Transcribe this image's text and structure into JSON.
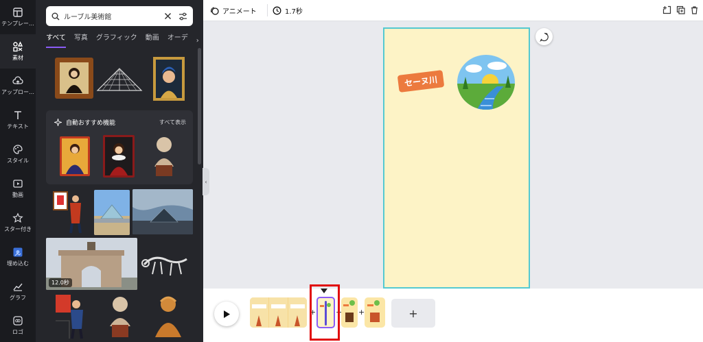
{
  "rail": {
    "items": [
      {
        "label": "テンプレー…",
        "icon": "template-icon"
      },
      {
        "label": "素材",
        "icon": "elements-icon"
      },
      {
        "label": "アップロー…",
        "icon": "upload-icon"
      },
      {
        "label": "テキスト",
        "icon": "text-icon"
      },
      {
        "label": "スタイル",
        "icon": "palette-icon"
      },
      {
        "label": "動画",
        "icon": "video-icon"
      },
      {
        "label": "スター付き",
        "icon": "star-icon"
      },
      {
        "label": "埋め込む",
        "icon": "embed-icon"
      },
      {
        "label": "グラフ",
        "icon": "chart-icon"
      },
      {
        "label": "ロゴ",
        "icon": "logo-icon"
      }
    ]
  },
  "panel": {
    "search_value": "ルーブル美術館",
    "tabs": [
      "すべて",
      "写真",
      "グラフィック",
      "動画",
      "オーデ"
    ],
    "feature": {
      "title": "自動おすすめ機能",
      "see_all": "すべて表示"
    },
    "video_duration": "12.0秒"
  },
  "topbar": {
    "animate_label": "アニメート",
    "duration": "1.7秒"
  },
  "canvas": {
    "badge_text": "セーヌ川"
  },
  "timeline": {
    "add_label": "+"
  },
  "colors": {
    "accent": "#8b5cf6",
    "page_bg": "#fdf3c6",
    "badge": "#ec7a3e",
    "selection": "#e10a0a"
  }
}
